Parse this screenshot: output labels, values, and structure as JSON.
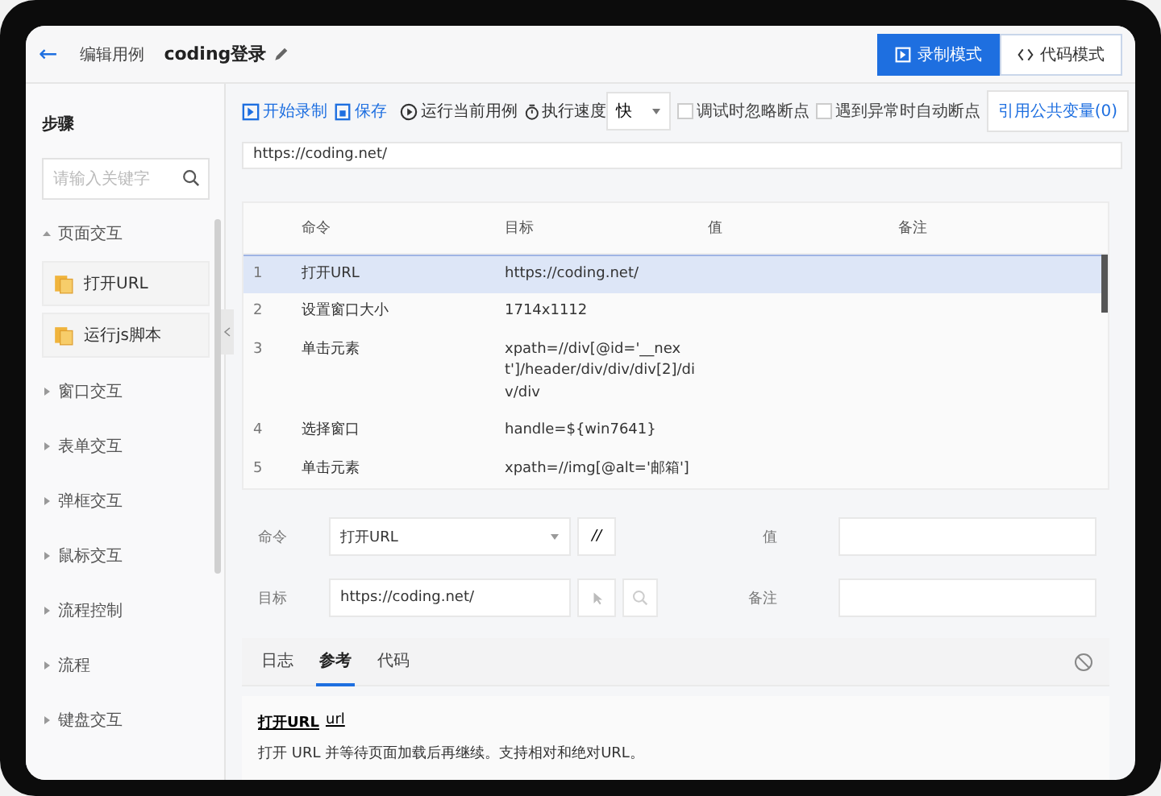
{
  "header": {
    "back": "←",
    "section": "编辑用例",
    "title": "coding登录",
    "modes": [
      {
        "label": "录制模式",
        "selected": true
      },
      {
        "label": "代码模式",
        "selected": false
      }
    ]
  },
  "sidebar": {
    "title": "步骤",
    "search": {
      "placeholder": "请输入关键字"
    },
    "groups": [
      {
        "label": "页面交互",
        "expanded": true,
        "children": [
          {
            "label": "打开URL"
          },
          {
            "label": "运行js脚本"
          }
        ]
      },
      {
        "label": "窗口交互",
        "expanded": false
      },
      {
        "label": "表单交互",
        "expanded": false
      },
      {
        "label": "弹框交互",
        "expanded": false
      },
      {
        "label": "鼠标交互",
        "expanded": false
      },
      {
        "label": "流程控制",
        "expanded": false
      },
      {
        "label": "流程",
        "expanded": false
      },
      {
        "label": "键盘交互",
        "expanded": false
      }
    ]
  },
  "toolbar": {
    "record": "开始录制",
    "save": "保存",
    "run": "运行当前用例",
    "speed_label": "执行速度",
    "speed": "快",
    "checks": [
      {
        "label": "调试时忽略断点",
        "checked": false
      },
      {
        "label": "遇到异常时自动断点",
        "checked": false
      }
    ],
    "variables": "引用公共变量(0)"
  },
  "url": {
    "value": "https://coding.net/"
  },
  "table": {
    "columns": [
      "命令",
      "目标",
      "值",
      "备注"
    ],
    "rows": [
      {
        "index": "1",
        "command": "打开URL",
        "target": "https://coding.net/",
        "selected": true
      },
      {
        "index": "2",
        "command": "设置窗口大小",
        "target": "1714x1112",
        "selected": false
      },
      {
        "index": "3",
        "command": "单击元素",
        "target": "xpath=//div[@id='__next']/header/div/div/div[2]/div/div",
        "selected": false
      },
      {
        "index": "4",
        "command": "选择窗口",
        "target": "handle=${win7641}",
        "selected": false
      },
      {
        "index": "5",
        "command": "单击元素",
        "target": "xpath=//img[@alt='邮箱']",
        "selected": false
      }
    ]
  },
  "editor": {
    "command_label": "命令",
    "command": "打开URL",
    "comment": "//",
    "target_label": "目标",
    "target": "https://coding.net/",
    "value_label": "值",
    "note_label": "备注"
  },
  "tabs": [
    {
      "label": "日志",
      "selected": false
    },
    {
      "label": "参考",
      "selected": true
    },
    {
      "label": "代码",
      "selected": false
    }
  ],
  "reference": {
    "title": "打开URL",
    "argument": "url",
    "description": "打开 URL 并等待页面加载后再继续。支持相对和绝对URL。"
  }
}
